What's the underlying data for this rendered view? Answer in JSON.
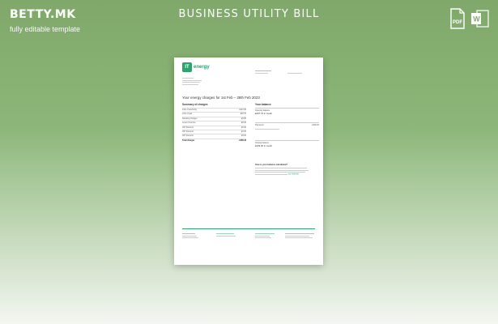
{
  "brand": {
    "logo": "BETTY.MK",
    "tagline": "fully editable template"
  },
  "title": "BUSINESS UTILITY BILL",
  "icons": [
    {
      "name": "pdf-file-icon",
      "label": "PDF",
      "color": "#ffffff"
    },
    {
      "name": "word-file-icon",
      "label": "W",
      "color": "#ffffff"
    }
  ],
  "document": {
    "logo_text": "energy",
    "logo_mark": "IT",
    "bill_title": "Your energy charges for 1st Feb – 28th Feb 2023",
    "summary_heading": "Summary of charges",
    "summary_rows": [
      {
        "label": "Cost of electricity",
        "value": "£112.96"
      },
      {
        "label": "Cost of gas",
        "value": "£94.75"
      },
      {
        "label": "Standing charges",
        "value": "£5.80"
      },
      {
        "label": "Level of service",
        "value": "£8.30"
      },
      {
        "label": "VAT discount",
        "value": "£6.00"
      },
      {
        "label": "VAT discount",
        "value": "£0.00"
      },
      {
        "label": "VAT discount",
        "value": "£0.00"
      }
    ],
    "total_label": "Total charges",
    "total_value": "£368.43",
    "breakdown_heading": "Your balance",
    "opening_balance_label": "Opening balance",
    "opening_balance_value": "£297.79 in credit",
    "payments_label": "Payments",
    "payments_value": "£300.00",
    "closing_balance_label": "Closing balance",
    "closing_balance_value": "£229.36 in credit",
    "note_heading": "How is your balance calculated?",
    "note_link": "our website",
    "link_color": "#2ea36b"
  }
}
